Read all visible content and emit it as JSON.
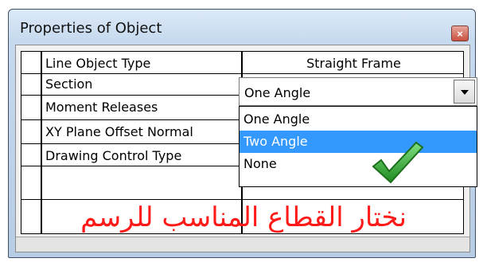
{
  "window": {
    "title": "Properties of Object",
    "close_glyph": "×"
  },
  "properties": [
    {
      "label": "Line Object Type",
      "value": "Straight Frame"
    },
    {
      "label": "Section",
      "value": "One Angle"
    },
    {
      "label": "Moment Releases",
      "value": ""
    },
    {
      "label": "XY Plane Offset Normal",
      "value": ""
    },
    {
      "label": "Drawing Control Type",
      "value": ""
    }
  ],
  "section_dropdown": {
    "selected": "One Angle",
    "options": [
      "One Angle",
      "Two Angle",
      "None"
    ],
    "highlighted": "Two Angle"
  },
  "overlay": {
    "checkmark_icon": "green-checkmark-icon",
    "caption": "نختار القطاع المناسب للرسم"
  },
  "colors": {
    "highlight": "#3399ff",
    "caption": "#ff1a1a",
    "checkmark": "#2fa52f"
  }
}
